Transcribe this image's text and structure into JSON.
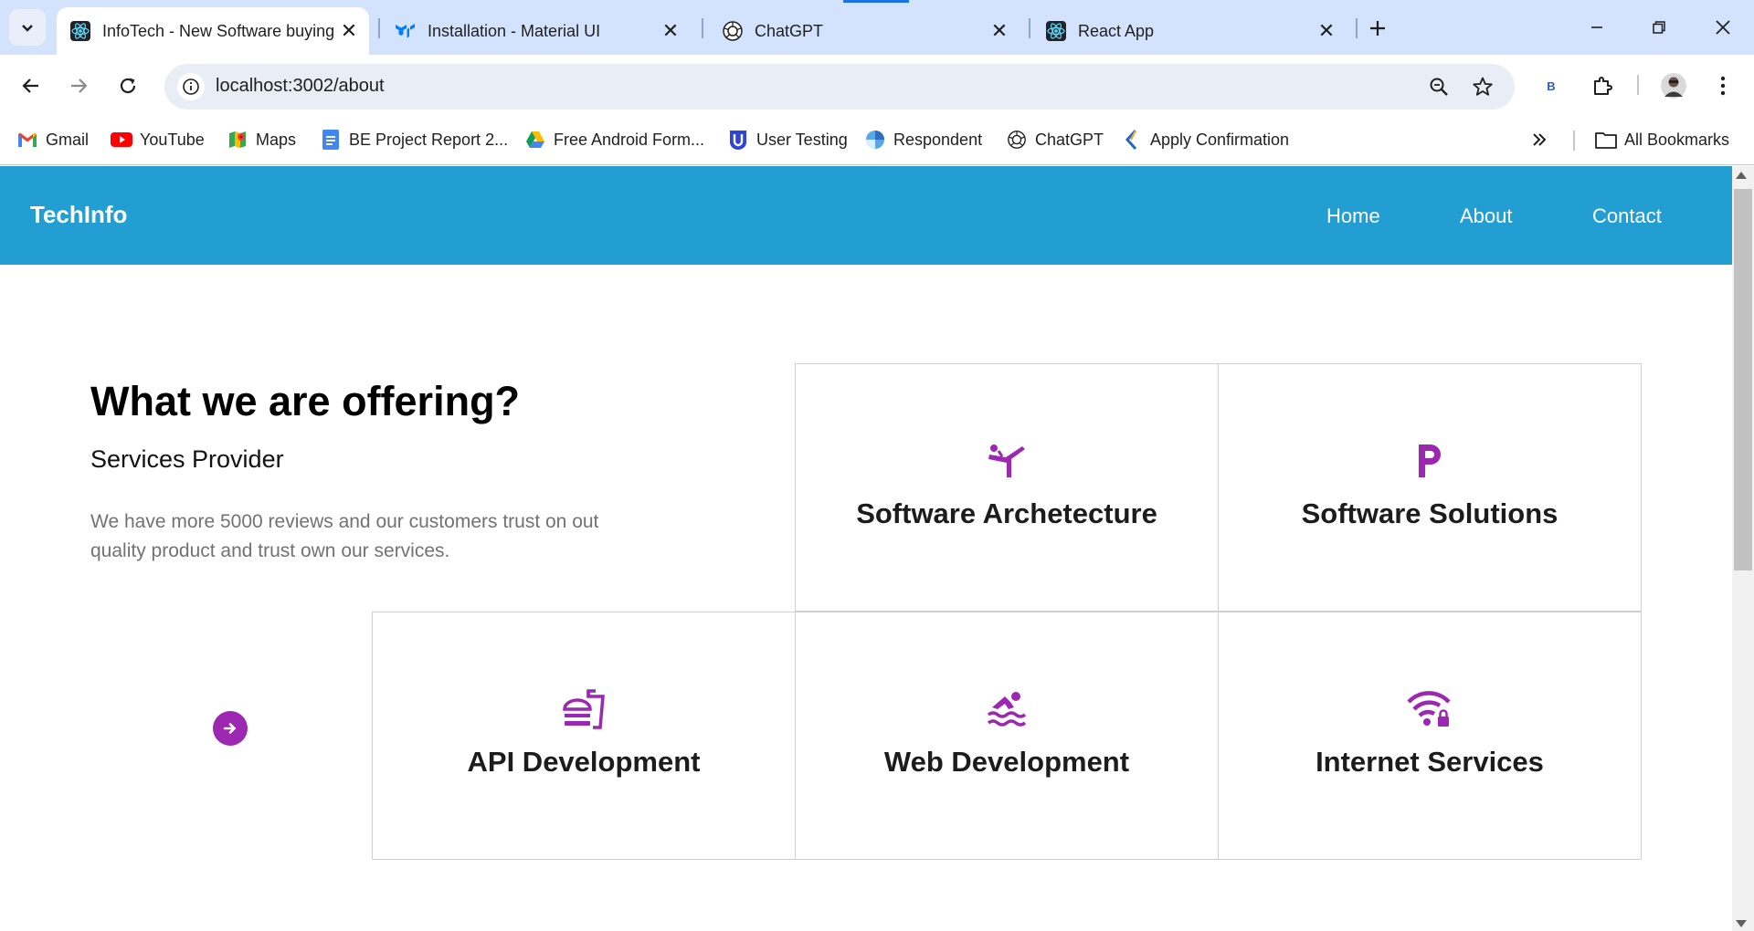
{
  "browser": {
    "tabs": [
      {
        "title": "InfoTech - New Software buying",
        "icon": "react-icon",
        "active": true
      },
      {
        "title": "Installation - Material UI",
        "icon": "mui-icon",
        "active": false
      },
      {
        "title": "ChatGPT",
        "icon": "chatgpt-icon",
        "active": false
      },
      {
        "title": "React App",
        "icon": "react-icon",
        "active": false
      }
    ],
    "address": "localhost:3002/about",
    "profile_initial": "B",
    "bookmarks": [
      {
        "label": "Gmail",
        "icon": "gmail-icon"
      },
      {
        "label": "YouTube",
        "icon": "youtube-icon"
      },
      {
        "label": "Maps",
        "icon": "maps-icon"
      },
      {
        "label": "BE Project Report 2...",
        "icon": "docs-icon"
      },
      {
        "label": "Free Android Form...",
        "icon": "drive-icon"
      },
      {
        "label": "User Testing",
        "icon": "usertesting-icon"
      },
      {
        "label": "Respondent",
        "icon": "respondent-icon"
      },
      {
        "label": "ChatGPT",
        "icon": "chatgpt-icon"
      },
      {
        "label": "Apply Confirmation",
        "icon": "apply-icon"
      }
    ],
    "all_bookmarks": "All Bookmarks"
  },
  "site": {
    "brand": "TechInfo",
    "nav": [
      "Home",
      "About",
      "Contact"
    ],
    "accent_color": "#229ed3",
    "icon_color": "#9c27b0"
  },
  "about": {
    "heading": "What we are offering?",
    "subheading": "Services Provider",
    "description": "We have more 5000 reviews and our customers trust on out quality product and trust own our services."
  },
  "services": [
    {
      "title": "Software Archetecture",
      "icon": "sports-gymnastics-icon"
    },
    {
      "title": "Software Solutions",
      "icon": "local-parking-icon"
    },
    {
      "title": "API Development",
      "icon": "fastfood-icon"
    },
    {
      "title": "Web Development",
      "icon": "pool-icon"
    },
    {
      "title": "Internet Services",
      "icon": "wifi-lock-icon"
    }
  ]
}
